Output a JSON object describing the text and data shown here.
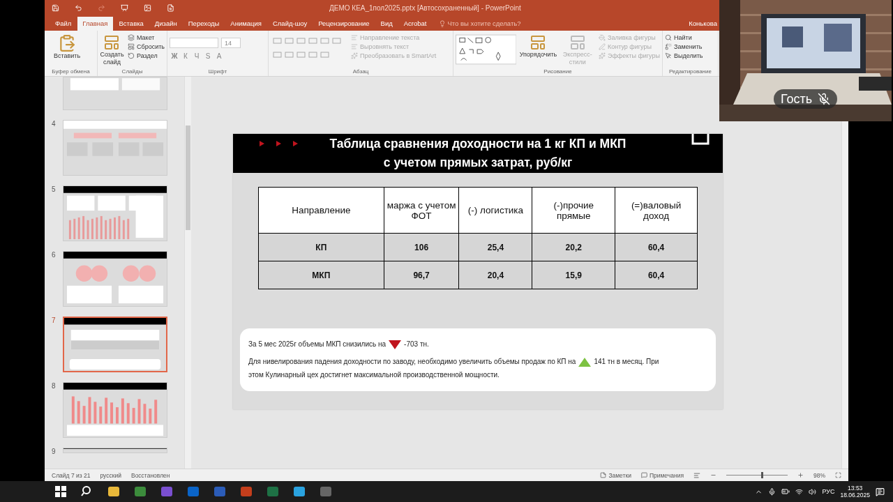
{
  "window": {
    "title": "ДЕМО КЕА_1пол2025.pptx [Автосохраненный] - PowerPoint"
  },
  "tabs": [
    {
      "label": "Файл",
      "selected": false
    },
    {
      "label": "Главная",
      "selected": true
    },
    {
      "label": "Вставка",
      "selected": false
    },
    {
      "label": "Дизайн",
      "selected": false
    },
    {
      "label": "Переходы",
      "selected": false
    },
    {
      "label": "Анимация",
      "selected": false
    },
    {
      "label": "Слайд-шоу",
      "selected": false
    },
    {
      "label": "Рецензирование",
      "selected": false
    },
    {
      "label": "Вид",
      "selected": false
    },
    {
      "label": "Acrobat",
      "selected": false
    }
  ],
  "tell_me": {
    "placeholder": "Что вы хотите сделать?"
  },
  "user": "Конькова",
  "ribbon": [
    {
      "label": "Буфер обмена",
      "items": [
        {
          "kind": "large",
          "text": "Вставить",
          "disabled": false
        }
      ]
    },
    {
      "label": "Слайды",
      "items": [
        {
          "kind": "large",
          "text": "Создать слайд",
          "disabled": false
        },
        {
          "kind": "small",
          "text": "Макет",
          "disabled": false
        },
        {
          "kind": "small",
          "text": "Сбросить",
          "disabled": false
        },
        {
          "kind": "small",
          "text": "Раздел",
          "disabled": false
        }
      ]
    },
    {
      "label": "Шрифт",
      "items": [
        {
          "kind": "field",
          "value": "14"
        },
        {
          "kind": "glyph",
          "text": "Ж"
        },
        {
          "kind": "glyph",
          "text": "К"
        },
        {
          "kind": "glyph",
          "text": "Ч"
        },
        {
          "kind": "glyph",
          "text": "S"
        },
        {
          "kind": "glyph",
          "text": "A"
        }
      ]
    },
    {
      "label": "Абзац",
      "items": [
        {
          "kind": "icon-grid"
        },
        {
          "kind": "small",
          "text": "Направление текста",
          "disabled": true
        },
        {
          "kind": "small",
          "text": "Выровнять текст",
          "disabled": true
        },
        {
          "kind": "small",
          "text": "Преобразовать в SmartArt",
          "disabled": true
        }
      ]
    },
    {
      "label": "Рисование",
      "items": [
        {
          "kind": "shape-gallery"
        },
        {
          "kind": "large",
          "text": "Упорядочить",
          "disabled": false
        },
        {
          "kind": "large",
          "text": "Экспресс-стили",
          "disabled": true
        },
        {
          "kind": "small",
          "text": "Заливка фигуры",
          "disabled": true
        },
        {
          "kind": "small",
          "text": "Контур фигуры",
          "disabled": true
        },
        {
          "kind": "small",
          "text": "Эффекты фигуры",
          "disabled": true
        }
      ]
    },
    {
      "label": "Редактирование",
      "items": [
        {
          "kind": "small",
          "text": "Найти",
          "disabled": false
        },
        {
          "kind": "small",
          "text": "Заменить",
          "disabled": false
        },
        {
          "kind": "small",
          "text": "Выделить",
          "disabled": false
        }
      ]
    }
  ],
  "thumbnails": [
    {
      "kind": "sheet",
      "selected": false
    },
    {
      "number": "4",
      "kind": "boxes",
      "selected": false
    },
    {
      "number": "5",
      "kind": "dashboard",
      "selected": false
    },
    {
      "number": "6",
      "kind": "pies",
      "selected": false
    },
    {
      "number": "7",
      "kind": "table",
      "selected": true
    },
    {
      "number": "8",
      "kind": "bars",
      "selected": false
    },
    {
      "number": "9",
      "kind": "sliver",
      "selected": false
    }
  ],
  "slide": {
    "title": [
      "Таблица сравнения доходности на 1 кг КП и МКП",
      "с учетом прямых затрат, руб/кг"
    ],
    "table": {
      "columns": [
        "Направление",
        "маржа с учетом ФОТ",
        "(-) логистика",
        "(-)прочие прямые",
        "(=)валовый доход"
      ],
      "rows": [
        [
          "КП",
          "106",
          "25,4",
          "20,2",
          "60,4"
        ],
        [
          "МКП",
          "96,7",
          "20,4",
          "15,9",
          "60,4"
        ]
      ]
    },
    "note": [
      [
        {
          "kind": "text",
          "text": "За 5 мес 2025г объемы МКП снизились на"
        },
        {
          "kind": "down"
        },
        {
          "kind": "text",
          "text": "-703 тн."
        }
      ],
      [
        {
          "kind": "text",
          "text": "Для нивелирования падения доходности по заводу, необходимо увеличить объемы продаж по КП на"
        },
        {
          "kind": "up"
        },
        {
          "kind": "text",
          "text": "141 тн в месяц. При"
        },
        {
          "kind": "text",
          "text": "этом Кулинарный цех достигнет максимальной производственной мощности."
        }
      ]
    ]
  },
  "status_bar": {
    "slide": "Слайд 7 из 21",
    "language": "русский",
    "state": "Восстановлен",
    "notes": "Заметки",
    "comments": "Примечания",
    "zoom": {
      "level": 0.57,
      "reading": "98%"
    }
  },
  "video": {
    "name": "Гость",
    "muted": true
  },
  "taskbar": {
    "language": "РУС",
    "time": "13:53",
    "date": "18.06.2025"
  }
}
